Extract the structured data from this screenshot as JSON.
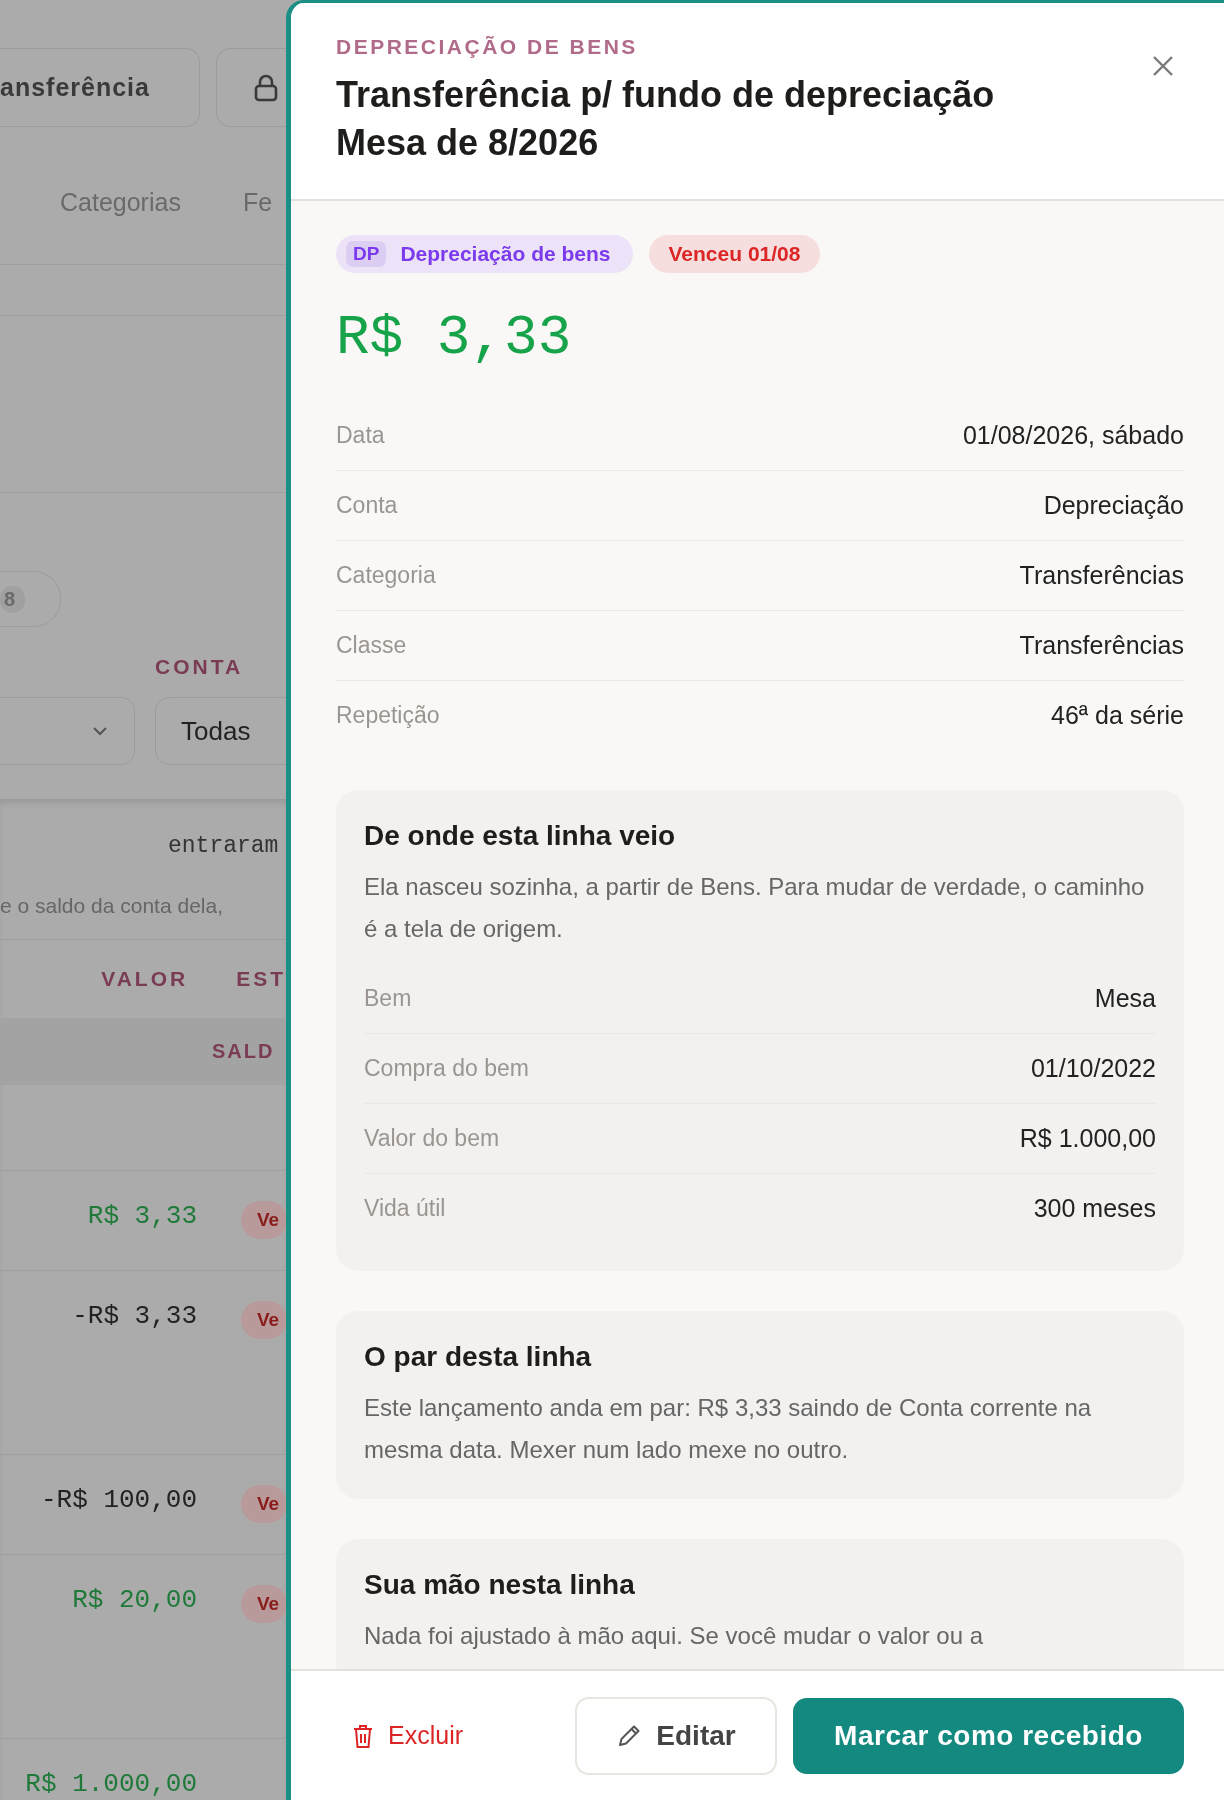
{
  "background": {
    "transfer_button": "ansferência",
    "tabs": [
      "Categorias",
      "Fe"
    ],
    "count_badge": "8",
    "account_filter": {
      "label": "CONTA",
      "value": "Todas"
    },
    "notes": [
      "entraram",
      "e o saldo da conta dela,"
    ],
    "table": {
      "columns": [
        "VALOR",
        "EST"
      ],
      "group_header": "SALD",
      "rows": [
        {
          "value": "R$ 3,33",
          "positive": true,
          "status": "Ve"
        },
        {
          "value": "-R$ 3,33",
          "positive": false,
          "status": "Ve"
        },
        {
          "value": "-R$ 100,00",
          "positive": false,
          "status": "Ve"
        },
        {
          "value": "R$ 20,00",
          "positive": true,
          "status": "Ve"
        },
        {
          "value": "R$ 1.000,00",
          "positive": true
        }
      ]
    }
  },
  "drawer": {
    "kicker": "DEPRECIAÇÃO DE BENS",
    "title_lines": [
      "Transferência p/ fundo de depreciação",
      "Mesa de 8/2026"
    ],
    "chips": [
      {
        "kind": "category",
        "code": "DP",
        "label": "Depreciação de bens"
      },
      {
        "kind": "status",
        "label": "Venceu 01/08"
      }
    ],
    "amount": "R$ 3,33",
    "details": [
      {
        "label": "Data",
        "value": "01/08/2026, sábado"
      },
      {
        "label": "Conta",
        "value": "Depreciação"
      },
      {
        "label": "Categoria",
        "value": "Transferências"
      },
      {
        "label": "Classe",
        "value": "Transferências"
      },
      {
        "label": "Repetição",
        "value": "46ª da série"
      }
    ],
    "cards": [
      {
        "title": "De onde esta linha veio",
        "text": "Ela nasceu sozinha, a partir de Bens. Para mudar de verdade, o caminho é a tela de origem.",
        "details": [
          {
            "label": "Bem",
            "value": "Mesa"
          },
          {
            "label": "Compra do bem",
            "value": "01/10/2022"
          },
          {
            "label": "Valor do bem",
            "value": "R$ 1.000,00"
          },
          {
            "label": "Vida útil",
            "value": "300 meses"
          }
        ]
      },
      {
        "title": "O par desta linha",
        "text": "Este lançamento anda em par: R$ 3,33 saindo de Conta corrente na mesma data. Mexer num lado mexe no outro."
      },
      {
        "title": "Sua mão nesta linha",
        "text": "Nada foi ajustado à mão aqui. Se você mudar o valor ou a"
      }
    ],
    "footer": {
      "delete": "Excluir",
      "edit": "Editar",
      "primary": "Marcar como recebido"
    }
  }
}
